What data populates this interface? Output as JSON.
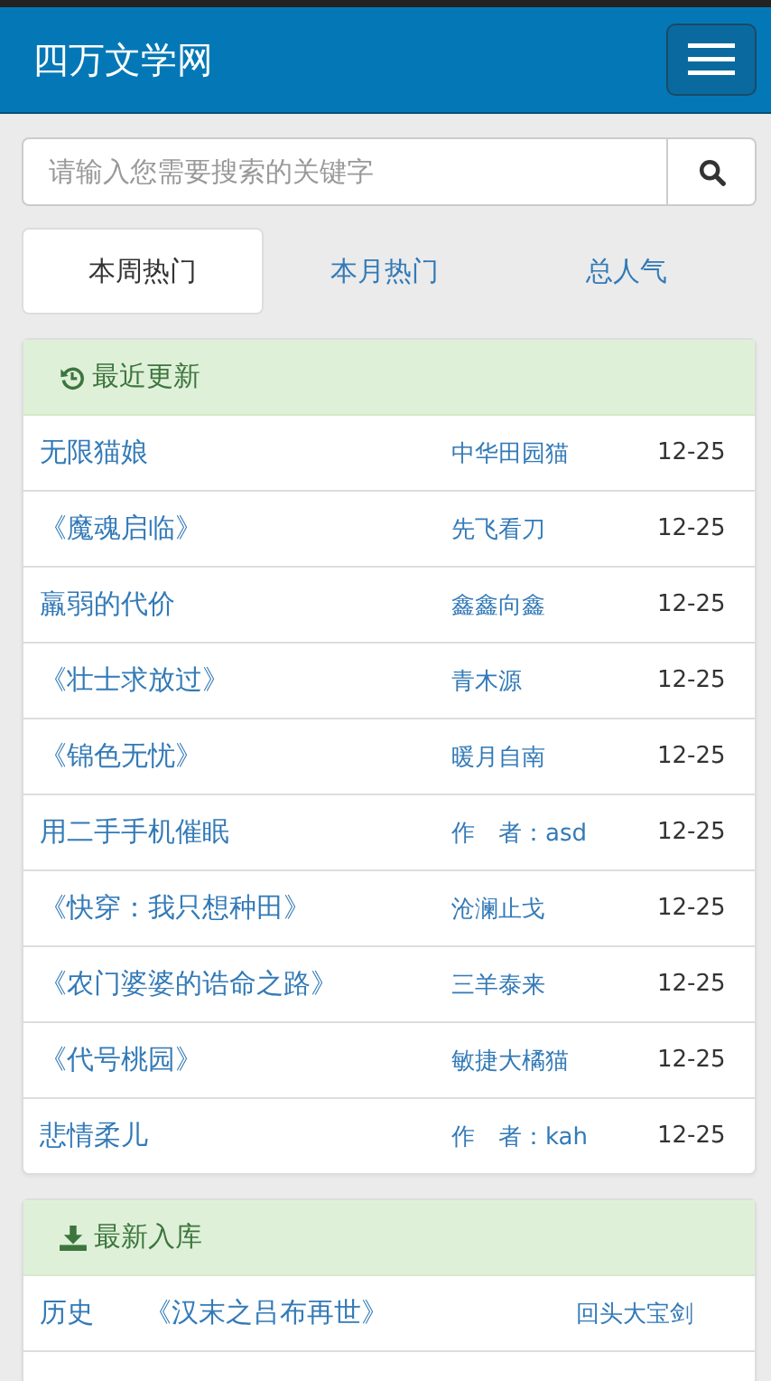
{
  "header": {
    "site_title": "四万文学网"
  },
  "search": {
    "placeholder": "请输入您需要搜索的关键字"
  },
  "tabs": [
    {
      "label": "本周热门",
      "selected": true
    },
    {
      "label": "本月热门",
      "selected": false
    },
    {
      "label": "总人气",
      "selected": false
    }
  ],
  "recent_updates": {
    "title": "最近更新",
    "rows": [
      {
        "title": "无限猫娘",
        "author": "中华田园猫",
        "date": "12-25"
      },
      {
        "title": "《魔魂启临》",
        "author": "先飞看刀",
        "date": "12-25"
      },
      {
        "title": "羸弱的代价",
        "author": "鑫鑫向鑫",
        "date": "12-25"
      },
      {
        "title": "《壮士求放过》",
        "author": "青木源",
        "date": "12-25"
      },
      {
        "title": "《锦色无忧》",
        "author": "暖月自南",
        "date": "12-25"
      },
      {
        "title": "用二手手机催眠",
        "author": "作　者：asd",
        "date": "12-25"
      },
      {
        "title": "《快穿：我只想种田》",
        "author": "沧澜止戈",
        "date": "12-25"
      },
      {
        "title": "《农门婆婆的诰命之路》",
        "author": "三羊泰来",
        "date": "12-25"
      },
      {
        "title": "《代号桃园》",
        "author": "敏捷大橘猫",
        "date": "12-25"
      },
      {
        "title": "悲情柔儿",
        "author": "作　者：kah",
        "date": "12-25"
      }
    ]
  },
  "new_arrivals": {
    "title": "最新入库",
    "rows": [
      {
        "category": "历史",
        "title": "《汉末之吕布再世》",
        "author": "回头大宝剑"
      }
    ]
  }
}
